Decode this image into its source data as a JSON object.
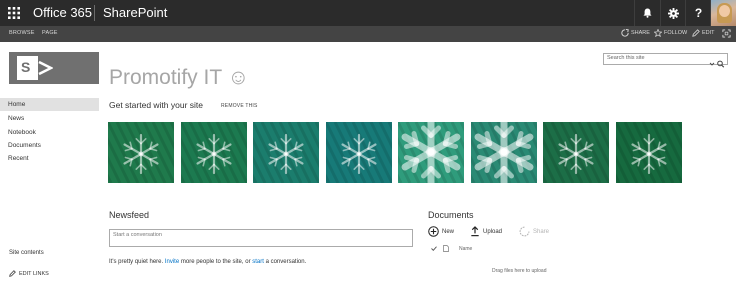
{
  "suite_bar": {
    "brand": "Office 365",
    "app": "SharePoint",
    "icons": [
      "app-launcher-icon",
      "bell-icon",
      "gear-icon",
      "help-icon"
    ],
    "help_glyph": "?"
  },
  "ribbon": {
    "tabs": [
      "BROWSE",
      "PAGE"
    ],
    "actions": [
      {
        "label": "SHARE",
        "icon": "share-icon"
      },
      {
        "label": "FOLLOW",
        "icon": "star-icon"
      },
      {
        "label": "EDIT",
        "icon": "pencil-icon"
      }
    ]
  },
  "site": {
    "title": "Promotify IT ☺",
    "logo_letter": "S"
  },
  "search": {
    "placeholder": "Search this site"
  },
  "quick_launch": {
    "items": [
      "Home",
      "News",
      "Notebook",
      "Documents",
      "Recent"
    ],
    "selected": "Home",
    "site_contents": "Site contents",
    "edit_links": "EDIT LINKS"
  },
  "get_started": {
    "heading": "Get started with your site",
    "remove": "REMOVE THIS",
    "tile_colors": [
      "#1f7a4c",
      "#1c7a50",
      "#1b7d6d",
      "#177a78",
      "#2f9c7c",
      "#2a8a74",
      "#1c6e47",
      "#166a3f"
    ]
  },
  "newsfeed": {
    "heading": "Newsfeed",
    "placeholder": "Start a conversation",
    "quiet_1": "It's pretty quiet here. ",
    "invite": "Invite",
    "quiet_2": " more people to the site, or ",
    "start": "start",
    "quiet_3": " a conversation."
  },
  "documents": {
    "heading": "Documents",
    "new": "New",
    "upload": "Upload",
    "share": "Share",
    "column_name": "Name",
    "drag": "Drag files here to upload"
  }
}
